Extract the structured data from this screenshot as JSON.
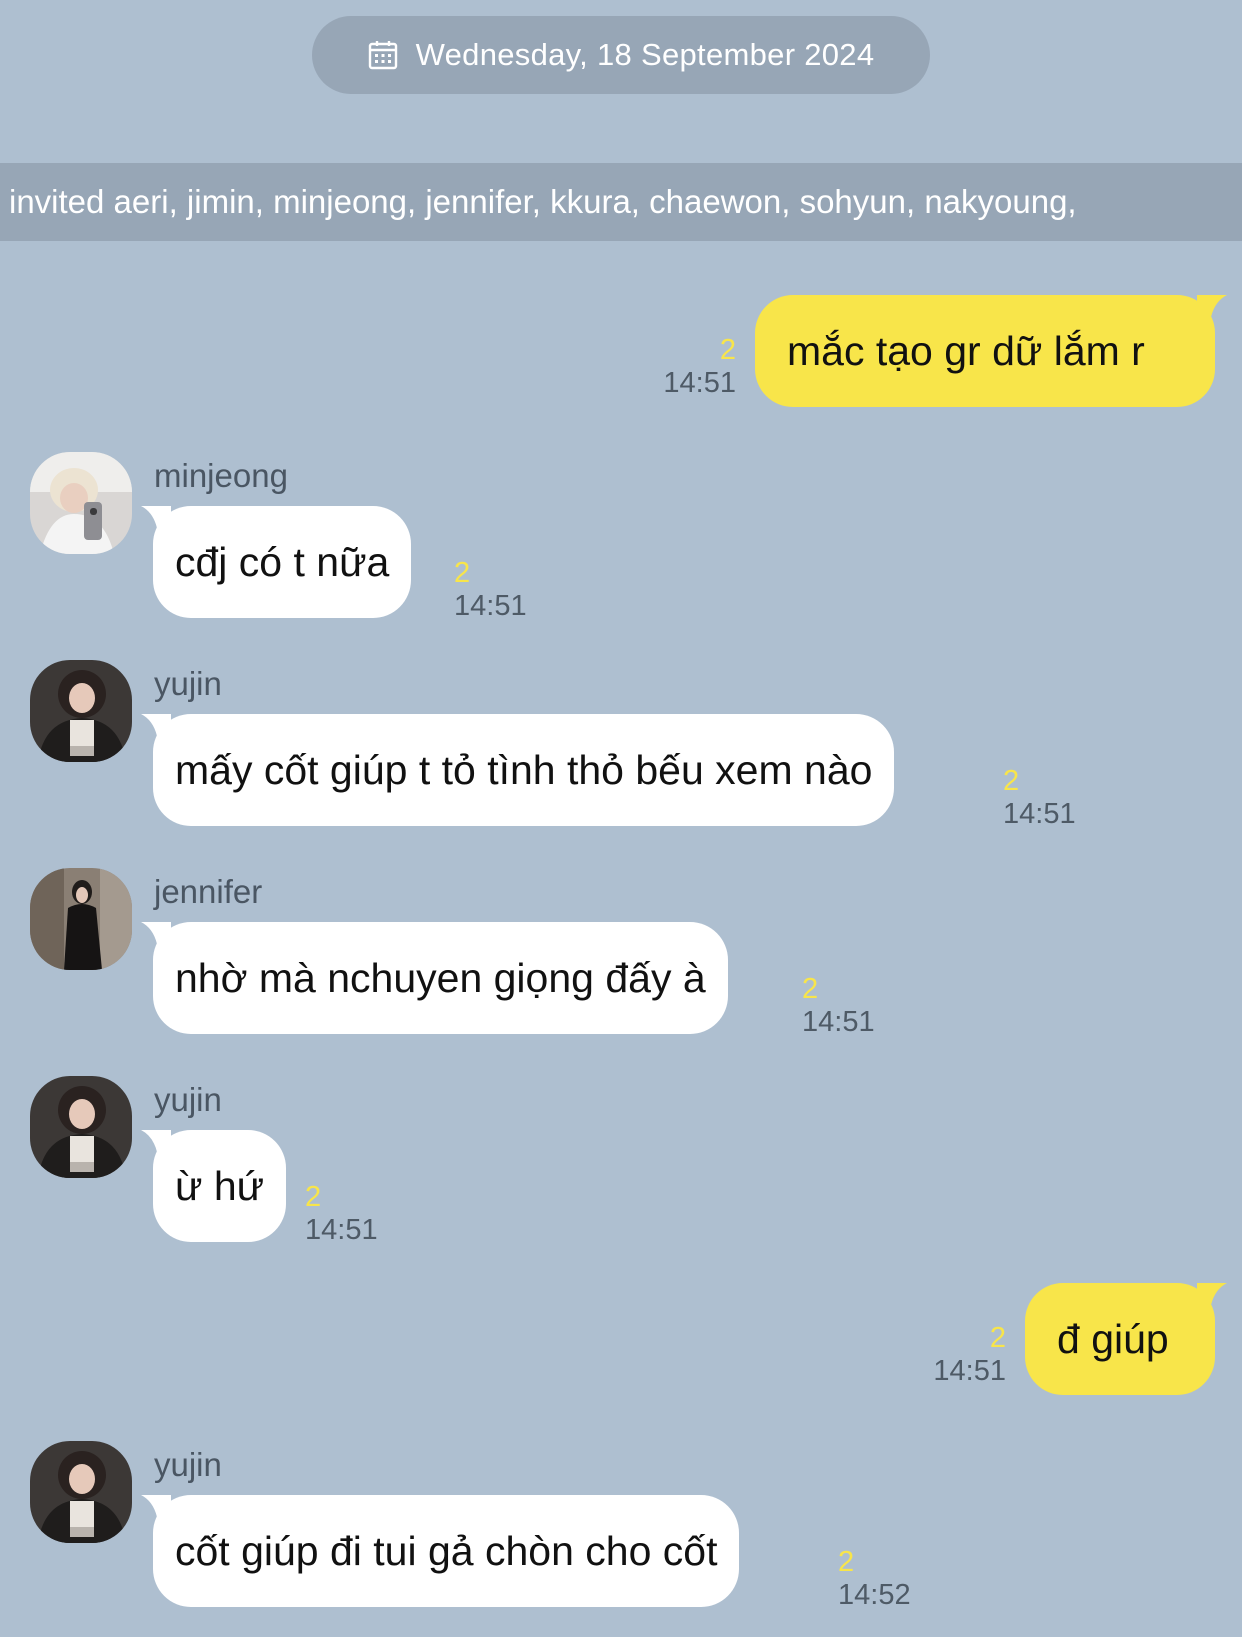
{
  "header": {
    "date_label": "Wednesday, 18 September 2024",
    "calendar_icon": "calendar-icon"
  },
  "system_notice": {
    "text": "invited aeri, jimin, minjeong, jennifer, kkura, chaewon, sohyun, nakyoung,"
  },
  "messages": [
    {
      "from_me": true,
      "text": "mắc tạo gr dữ lắm r",
      "unread": "2",
      "time": "14:51"
    },
    {
      "from_me": false,
      "sender": "minjeong",
      "text": "cđj có t nữa",
      "unread": "2",
      "time": "14:51"
    },
    {
      "from_me": false,
      "sender": "yujin",
      "text": "mấy cốt giúp t tỏ tình thỏ bếu xem nào",
      "unread": "2",
      "time": "14:51"
    },
    {
      "from_me": false,
      "sender": "jennifer",
      "text": "nhờ mà nchuyen giọng đấy à",
      "unread": "2",
      "time": "14:51"
    },
    {
      "from_me": false,
      "sender": "yujin",
      "text": "ừ hứ",
      "unread": "2",
      "time": "14:51"
    },
    {
      "from_me": true,
      "text": "đ giúp",
      "unread": "2",
      "time": "14:51"
    },
    {
      "from_me": false,
      "sender": "yujin",
      "text": "cốt giúp đi tui gả chòn cho cốt",
      "unread": "2",
      "time": "14:52"
    }
  ],
  "colors": {
    "background": "#aebfd0",
    "pill": "#97a6b6",
    "my_bubble": "#f8e54a",
    "their_bubble": "#ffffff",
    "unread_count": "#f8e54a"
  }
}
